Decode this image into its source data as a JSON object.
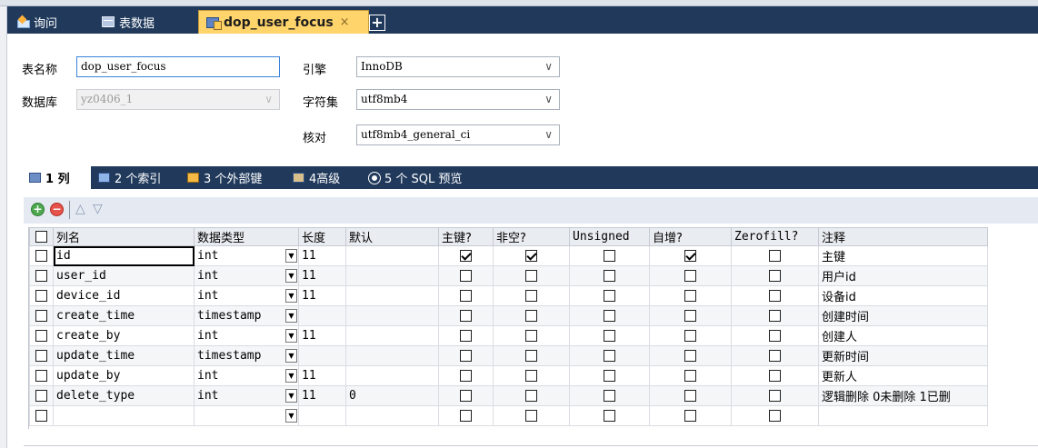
{
  "tabs": [
    {
      "label": "询问",
      "icon": "query-edit-icon"
    },
    {
      "label": "表数据",
      "icon": "table-icon"
    },
    {
      "label": "dop_user_focus",
      "icon": "table-design-icon",
      "close": "×",
      "active": true
    }
  ],
  "new_tab_label": "+",
  "form": {
    "table_name_label": "表名称",
    "table_name": "dop_user_focus",
    "database_label": "数据库",
    "database": "yz0406_1",
    "engine_label": "引擎",
    "engine": "InnoDB",
    "charset_label": "字符集",
    "charset": "utf8mb4",
    "collation_label": "核对",
    "collation": "utf8mb4_general_ci"
  },
  "subtabs": [
    {
      "label": "1 列",
      "active": true,
      "icon": "columns-icon"
    },
    {
      "label": "2 个索引",
      "icon": "index-icon"
    },
    {
      "label": "3 个外部键",
      "icon": "foreign-key-icon"
    },
    {
      "label": "4高级",
      "icon": "advanced-icon"
    },
    {
      "label": "5 个 SQL 预览",
      "icon": "sql-preview-icon"
    }
  ],
  "toolbar": {
    "add": "+",
    "remove": "−",
    "move_up": "△",
    "move_down": "▽"
  },
  "columns_header": [
    "列名",
    "数据类型",
    "长度",
    "默认",
    "主键?",
    "非空?",
    "Unsigned",
    "自增?",
    "Zerofill?",
    "注释"
  ],
  "rows": [
    {
      "name": "id",
      "type": "int",
      "length": "11",
      "default": "",
      "pk": true,
      "notnull": true,
      "unsigned": false,
      "autoinc": true,
      "zerofill": false,
      "comment": "主键"
    },
    {
      "name": "user_id",
      "type": "int",
      "length": "11",
      "default": "",
      "pk": false,
      "notnull": false,
      "unsigned": false,
      "autoinc": false,
      "zerofill": false,
      "comment": "用户id"
    },
    {
      "name": "device_id",
      "type": "int",
      "length": "11",
      "default": "",
      "pk": false,
      "notnull": false,
      "unsigned": false,
      "autoinc": false,
      "zerofill": false,
      "comment": "设备id"
    },
    {
      "name": "create_time",
      "type": "timestamp",
      "length": "",
      "default": "",
      "pk": false,
      "notnull": false,
      "unsigned": false,
      "autoinc": false,
      "zerofill": false,
      "comment": "创建时间"
    },
    {
      "name": "create_by",
      "type": "int",
      "length": "11",
      "default": "",
      "pk": false,
      "notnull": false,
      "unsigned": false,
      "autoinc": false,
      "zerofill": false,
      "comment": "创建人"
    },
    {
      "name": "update_time",
      "type": "timestamp",
      "length": "",
      "default": "",
      "pk": false,
      "notnull": false,
      "unsigned": false,
      "autoinc": false,
      "zerofill": false,
      "comment": "更新时间"
    },
    {
      "name": "update_by",
      "type": "int",
      "length": "11",
      "default": "",
      "pk": false,
      "notnull": false,
      "unsigned": false,
      "autoinc": false,
      "zerofill": false,
      "comment": "更新人"
    },
    {
      "name": "delete_type",
      "type": "int",
      "length": "11",
      "default": "0",
      "pk": false,
      "notnull": false,
      "unsigned": false,
      "autoinc": false,
      "zerofill": false,
      "comment": "逻辑删除 0未删除 1已删"
    },
    {
      "name": "",
      "type": "",
      "length": "",
      "default": "",
      "pk": false,
      "notnull": false,
      "unsigned": false,
      "autoinc": false,
      "zerofill": false,
      "comment": ""
    }
  ],
  "colors": {
    "tabbar": "#213a5c",
    "active_tab": "#ffd46b",
    "grid_header": "#e9ecf0"
  }
}
